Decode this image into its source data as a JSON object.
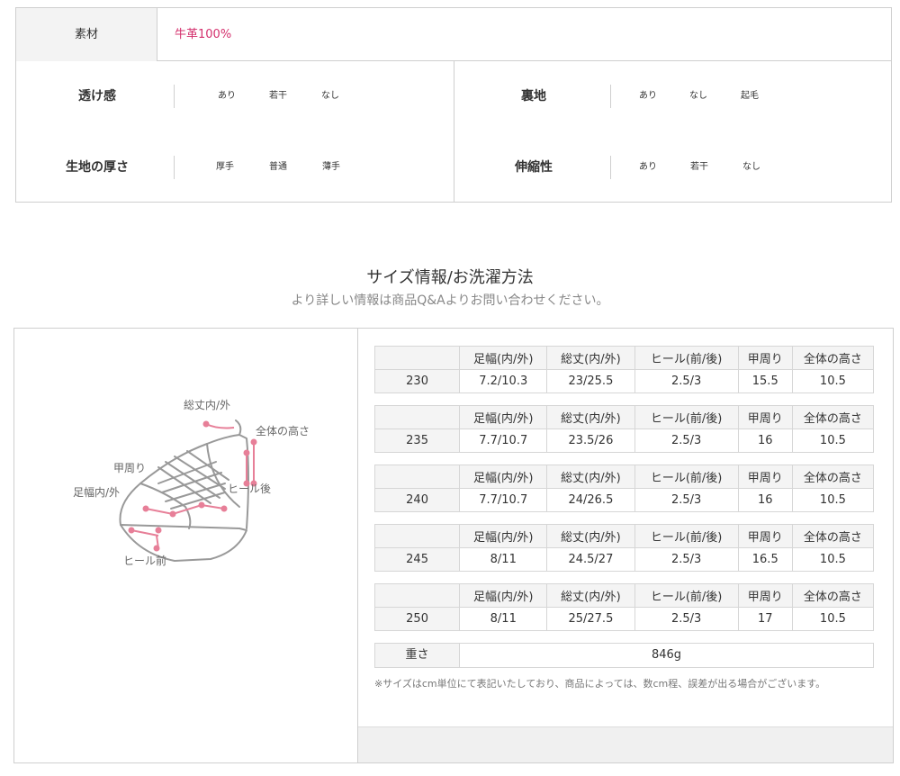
{
  "material": {
    "label": "素材",
    "value": "牛革100%"
  },
  "attributes": {
    "sheer": {
      "name": "透け感",
      "options": [
        "あり",
        "若干",
        "なし"
      ]
    },
    "lining": {
      "name": "裏地",
      "options": [
        "あり",
        "なし",
        "起毛"
      ]
    },
    "thickness": {
      "name": "生地の厚さ",
      "options": [
        "厚手",
        "普通",
        "薄手"
      ]
    },
    "stretch": {
      "name": "伸縮性",
      "options": [
        "あり",
        "若干",
        "なし"
      ]
    }
  },
  "size_section": {
    "title": "サイズ情報/お洗濯方法",
    "subtitle": "より詳しい情報は商品Q&Aよりお問い合わせください。"
  },
  "diagram_labels": {
    "total_length": "総丈内/外",
    "total_height": "全体の高さ",
    "instep": "甲周り",
    "width": "足幅内/外",
    "heel_back": "ヒール後",
    "heel_front": "ヒール前"
  },
  "headers": [
    "",
    "足幅(内/外)",
    "総丈(内/外)",
    "ヒール(前/後)",
    "甲周り",
    "全体の高さ"
  ],
  "sizes": [
    {
      "size": "230",
      "width": "7.2/10.3",
      "length": "23/25.5",
      "heel": "2.5/3",
      "instep": "15.5",
      "height": "10.5"
    },
    {
      "size": "235",
      "width": "7.7/10.7",
      "length": "23.5/26",
      "heel": "2.5/3",
      "instep": "16",
      "height": "10.5"
    },
    {
      "size": "240",
      "width": "7.7/10.7",
      "length": "24/26.5",
      "heel": "2.5/3",
      "instep": "16",
      "height": "10.5"
    },
    {
      "size": "245",
      "width": "8/11",
      "length": "24.5/27",
      "heel": "2.5/3",
      "instep": "16.5",
      "height": "10.5"
    },
    {
      "size": "250",
      "width": "8/11",
      "length": "25/27.5",
      "heel": "2.5/3",
      "instep": "17",
      "height": "10.5"
    }
  ],
  "weight": {
    "label": "重さ",
    "value": "846g"
  },
  "note": "※サイズはcm単位にて表記いたしており、商品によっては、数cm程、誤差が出る場合がございます。",
  "colors": {
    "accent": "#d4306d",
    "marker": "#e77f98",
    "header_bg": "#f4f4f4",
    "border": "#d6d6d6"
  }
}
